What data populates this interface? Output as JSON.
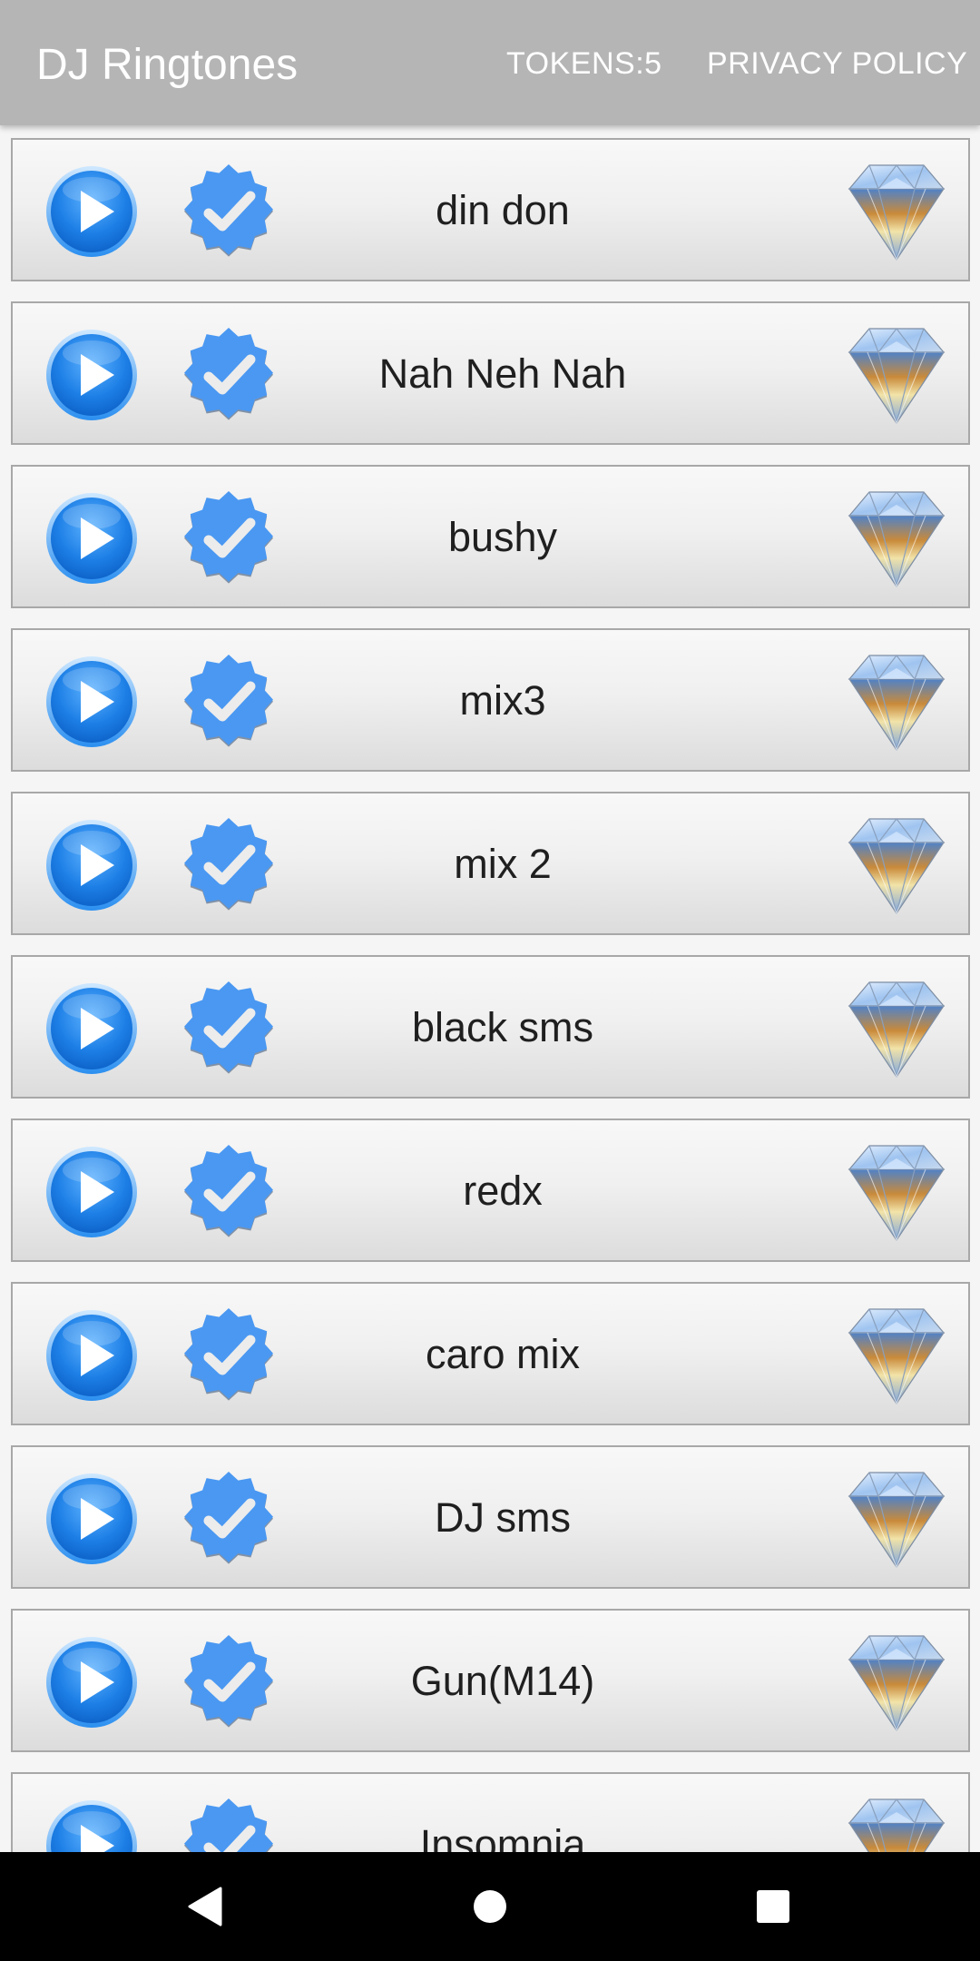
{
  "app_bar": {
    "title": "DJ Ringtones",
    "tokens": "TOKENS:5",
    "privacy": "PRIVACY POLICY"
  },
  "songs": [
    "din don",
    "Nah Neh Nah",
    "bushy",
    "mix3",
    "mix 2",
    "black sms",
    "redx",
    "caro mix",
    "DJ sms",
    "Gun(M14)",
    "Insomnia"
  ],
  "icons": {
    "play": "play-circle-icon",
    "select": "verified-check-badge-icon",
    "premium": "diamond-icon"
  },
  "colors": {
    "app_bar": "#b5b5b5",
    "play_blue": "#1e7fe6",
    "badge_blue": "#4a98f2",
    "nav_bar": "#000000"
  }
}
